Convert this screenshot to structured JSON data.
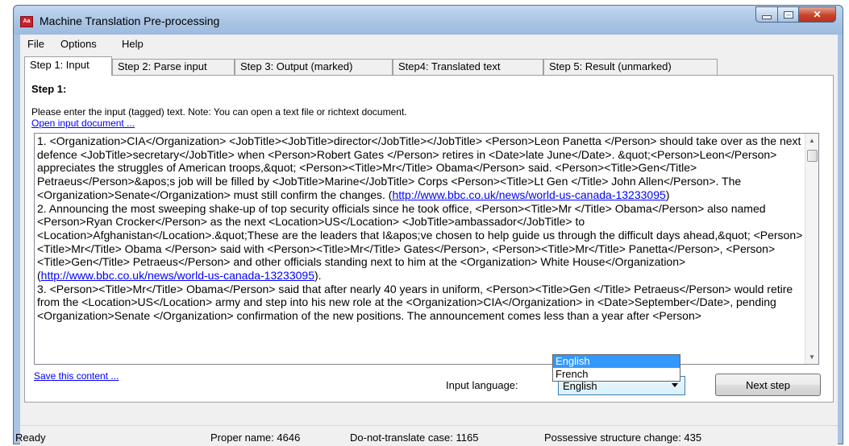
{
  "window": {
    "title": "Machine Translation Pre-processing",
    "app_icon_text": "Aa"
  },
  "menu": {
    "items": [
      "File",
      "Options",
      "Help"
    ]
  },
  "tabs": [
    {
      "label": "Step 1: Input",
      "active": true
    },
    {
      "label": "Step 2: Parse input",
      "active": false
    },
    {
      "label": "Step 3: Output (marked)",
      "active": false
    },
    {
      "label": "Step4: Translated text",
      "active": false
    },
    {
      "label": "Step 5: Result (unmarked)",
      "active": false
    }
  ],
  "step1": {
    "heading": "Step 1:",
    "instructions": "Please enter the input (tagged) text. Note: You can open a text file or richtext document.",
    "open_link": "Open input document ...",
    "save_link": "Save this content ...",
    "input_language_label": "Input language:",
    "selected_language": "English",
    "language_options": [
      "English",
      "French"
    ],
    "next_button": "Next step"
  },
  "editor": {
    "segments": [
      {
        "text": "1. <Organization>CIA</Organization> <JobTitle><JobTitle>director</JobTitle></JobTitle> <Person>Leon Panetta </Person> should take over as the next defence <JobTitle>secretary</JobTitle> when <Person>Robert Gates </Person> retires in <Date>late June</Date>. &quot;<Person>Leon</Person> appreciates the struggles of American troops,&quot; <Person><Title>Mr</Title> Obama</Person> said. <Person><Title>Gen</Title> Petraeus</Person>&apos;s job will be filled by <JobTitle>Marine</JobTitle> Corps <Person><Title>Lt Gen </Title> John Allen</Person>. The <Organization>Senate</Organization> must still confirm the changes. (",
        "link": false
      },
      {
        "text": "http://www.bbc.co.uk/news/world-us-canada-13233095",
        "link": true
      },
      {
        "text": ")\n2. Announcing the most sweeping shake-up of top security officials since he took office, <Person><Title>Mr </Title> Obama</Person> also named <Person>Ryan Crocker</Person> as the next <Location>US</Location> <JobTitle>ambassador</JobTitle> to <Location>Afghanistan</Location>.&quot;These are the leaders that I&apos;ve chosen to help guide us through the difficult days ahead,&quot; <Person><Title>Mr</Title> Obama </Person> said with <Person><Title>Mr</Title> Gates</Person>, <Person><Title>Mr</Title> Panetta</Person>, <Person><Title>Gen</Title> Petraeus</Person> and other officials standing next to him at the <Organization> White House</Organization> (",
        "link": false
      },
      {
        "text": "http://www.bbc.co.uk/news/world-us-canada-13233095",
        "link": true
      },
      {
        "text": ").\n3. <Person><Title>Mr</Title> Obama</Person> said that after nearly 40 years in uniform, <Person><Title>Gen </Title> Petraeus</Person> would retire from the <Location>US</Location> army and step into his new role at the <Organization>CIA</Organization> in <Date>September</Date>, pending <Organization>Senate </Organization> confirmation of the new positions. The announcement comes less than a year after <Person>",
        "link": false
      }
    ]
  },
  "status": {
    "ready": "Ready",
    "proper_name": "Proper name: 4646",
    "do_not_translate": "Do-not-translate case: 1165",
    "possessive": "Possessive structure change: 435"
  }
}
